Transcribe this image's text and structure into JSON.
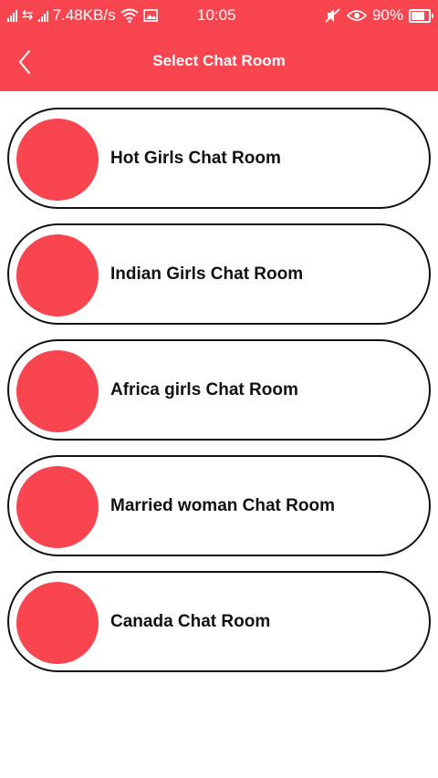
{
  "status_bar": {
    "network_speed": "7.48KB/s",
    "time": "10:05",
    "battery_percent": "90%",
    "battery_level": 0.9
  },
  "header": {
    "title": "Select Chat Room",
    "back_icon": "chevron-left-icon"
  },
  "colors": {
    "accent": "#f8454f",
    "border": "#111111",
    "text": "#111111",
    "background": "#ffffff"
  },
  "rooms": [
    {
      "name": "Hot Girls Chat Room"
    },
    {
      "name": "Indian Girls Chat Room"
    },
    {
      "name": "Africa girls Chat Room"
    },
    {
      "name": "Married woman Chat Room"
    },
    {
      "name": "Canada Chat Room"
    }
  ]
}
